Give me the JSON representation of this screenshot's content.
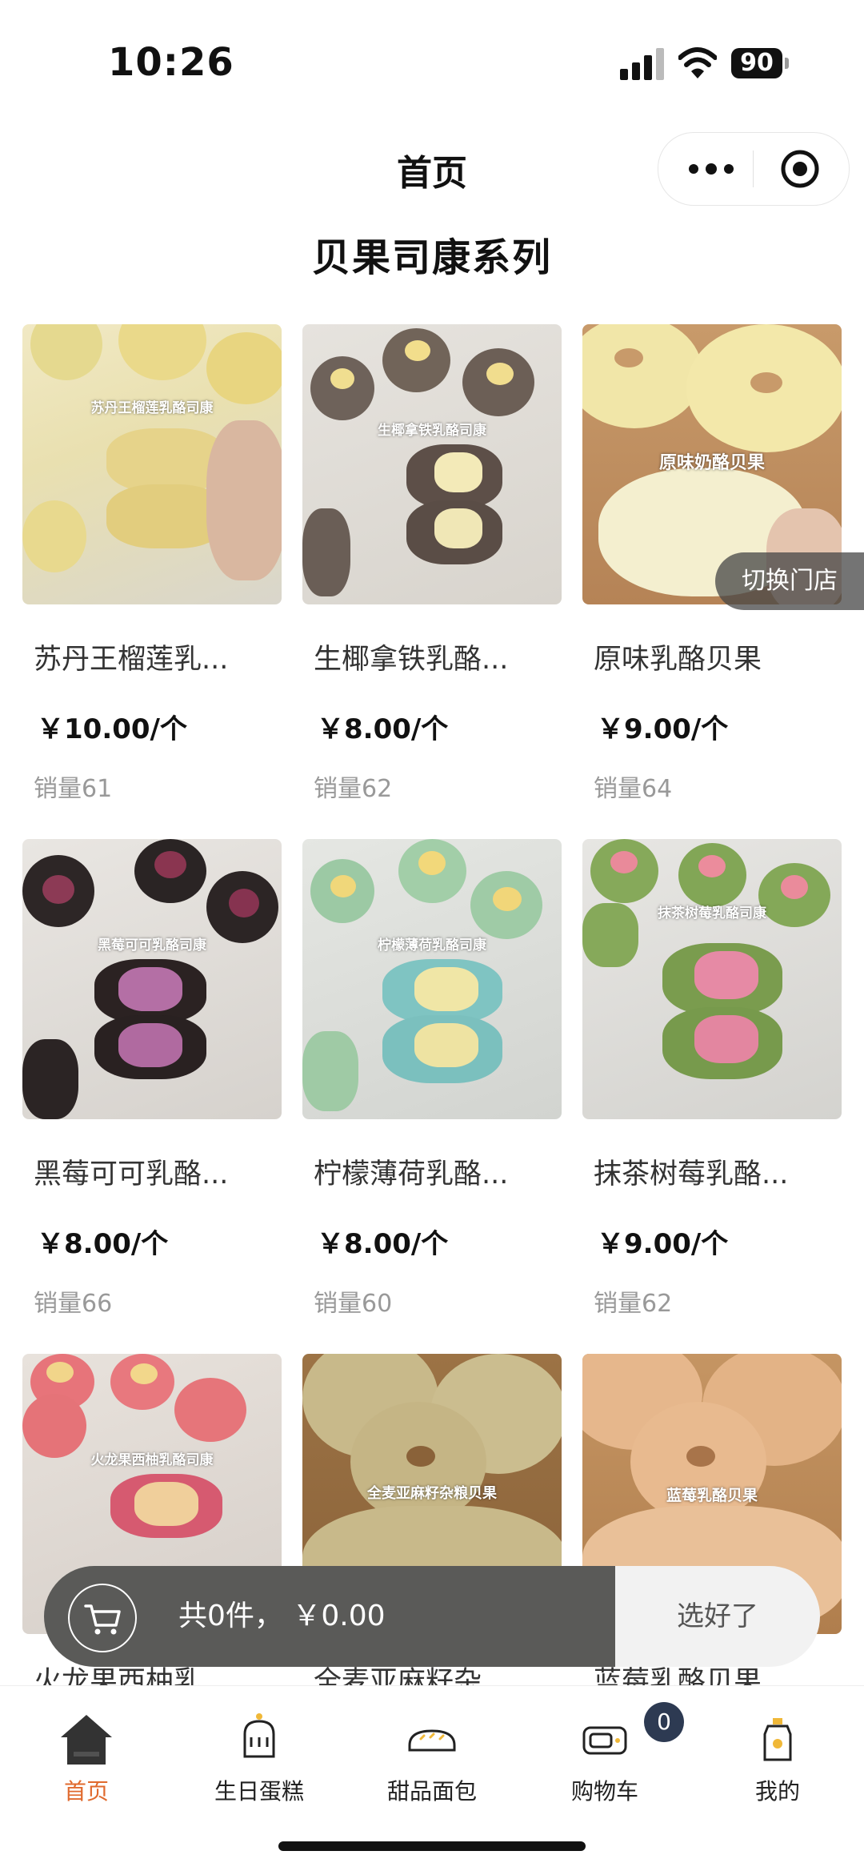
{
  "status_bar": {
    "time": "10:26",
    "battery": "90"
  },
  "nav": {
    "title": "首页"
  },
  "section_title": "贝果司康系列",
  "switch_store_label": "切换门店",
  "products": [
    {
      "name": "苏丹王榴莲乳...",
      "price": "￥10.00/个",
      "sales": "销量61",
      "tag": "苏丹王榴莲乳酪司康"
    },
    {
      "name": "生椰拿铁乳酪...",
      "price": "￥8.00/个",
      "sales": "销量62",
      "tag": "生椰拿铁乳酪司康"
    },
    {
      "name": "原味乳酪贝果",
      "price": "￥9.00/个",
      "sales": "销量64",
      "tag": "原味奶酪贝果"
    },
    {
      "name": "黑莓可可乳酪...",
      "price": "￥8.00/个",
      "sales": "销量66",
      "tag": "黑莓可可乳酪司康"
    },
    {
      "name": "柠檬薄荷乳酪...",
      "price": "￥8.00/个",
      "sales": "销量60",
      "tag": "柠檬薄荷乳酪司康"
    },
    {
      "name": "抹茶树莓乳酪...",
      "price": "￥9.00/个",
      "sales": "销量62",
      "tag": "抹茶树莓乳酪司康"
    },
    {
      "name": "火龙果西柚乳",
      "tag": "火龙果西柚乳酪司康"
    },
    {
      "name": "全麦亚麻籽杂",
      "tag": "全麦亚麻籽杂粮贝果"
    },
    {
      "name": "蓝莓乳酪贝果",
      "tag": "蓝莓乳酪贝果"
    }
  ],
  "cart": {
    "summary": "共0件，  ￥0.00",
    "checkout_label": "选好了"
  },
  "tabs": [
    {
      "label": "首页",
      "icon": "home-icon",
      "active": true
    },
    {
      "label": "生日蛋糕",
      "icon": "cake-icon"
    },
    {
      "label": "甜品面包",
      "icon": "bread-icon"
    },
    {
      "label": "购物车",
      "icon": "cart-icon",
      "badge": "0"
    },
    {
      "label": "我的",
      "icon": "profile-icon"
    }
  ],
  "colors": {
    "accent": "#e06a2e",
    "cart_bar": "#5a5a58",
    "badge": "#2d3a52"
  }
}
